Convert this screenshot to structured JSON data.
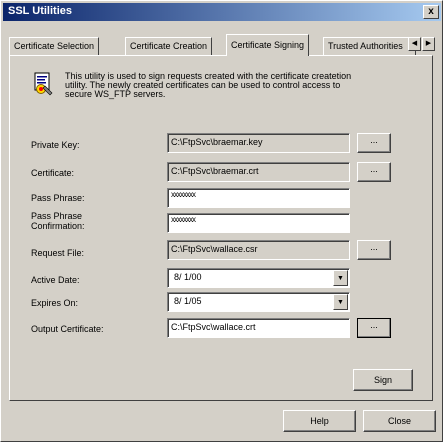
{
  "window": {
    "title": "SSL Utilities",
    "close_glyph": "x"
  },
  "tabs": [
    {
      "label": "Certificate Selection"
    },
    {
      "label": "Certificate Creation"
    },
    {
      "label": "Certificate Signing"
    },
    {
      "label": "Trusted Authorities"
    }
  ],
  "tab_scroll": {
    "left": "◀",
    "right": "▶"
  },
  "info": {
    "icon": "certificate-sign-icon",
    "text": "This utility is used to sign requests created with the certificate createtion utility. The newly created certificates can be used to control access to secure WS_FTP servers."
  },
  "form": {
    "private_key": {
      "label": "Private Key:",
      "value": "C:\\FtpSvc\\braemar.key"
    },
    "certificate": {
      "label": "Certificate:",
      "value": "C:\\FtpSvc\\braemar.crt"
    },
    "pass_phrase": {
      "label": "Pass Phrase:",
      "value": "xxxxxxxx"
    },
    "pass_phrase_confirm": {
      "label_line1": "Pass Phrase",
      "label_line2": "Confirmation:",
      "value": "xxxxxxxx"
    },
    "request_file": {
      "label": "Request File:",
      "value": "C:\\FtpSvc\\wallace.csr"
    },
    "active_date": {
      "label": "Active Date:",
      "value": "8/ 1/00"
    },
    "expires_on": {
      "label": "Expires On:",
      "value": "8/ 1/05"
    },
    "output_certificate": {
      "label": "Output Certificate:",
      "value": "C:\\FtpSvc\\wallace.crt"
    },
    "browse_label": "..."
  },
  "buttons": {
    "sign": "Sign",
    "help": "Help",
    "close": "Close"
  },
  "colors": {
    "face": "#d4d0c8",
    "title_start": "#0a246a",
    "title_end": "#a6caf0"
  }
}
